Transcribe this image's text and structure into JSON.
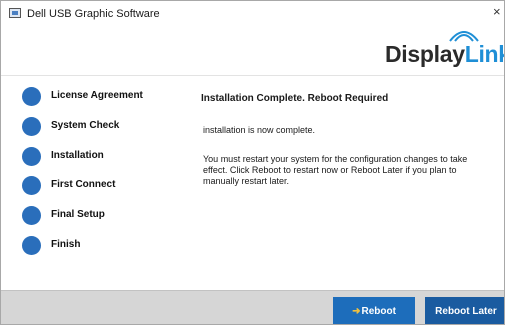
{
  "window": {
    "title": "Dell USB Graphic Software",
    "close_glyph": "×"
  },
  "logo": {
    "text_part1": "Display",
    "text_part2": "Link",
    "colors": {
      "dark": "#2b2b2b",
      "accent": "#1f8fd6"
    }
  },
  "steps": [
    {
      "label": "License Agreement"
    },
    {
      "label": "System Check"
    },
    {
      "label": "Installation"
    },
    {
      "label": "First Connect"
    },
    {
      "label": "Final Setup"
    },
    {
      "label": "Finish"
    }
  ],
  "content": {
    "heading": "Installation Complete. Reboot Required",
    "line1": "installation is now complete.",
    "paragraph": "You must restart your system for the configuration changes to take effect. Click Reboot to restart now or Reboot Later if you plan to manually restart later."
  },
  "buttons": {
    "reboot_label": "Reboot",
    "reboot_icon": "shield-icon",
    "later_label": "Reboot Later"
  },
  "colors": {
    "step_dot": "#2a6ebb",
    "button_primary": "#1d6dbb",
    "button_secondary": "#1a5ba0",
    "footer_bg": "#d6d6d6"
  }
}
